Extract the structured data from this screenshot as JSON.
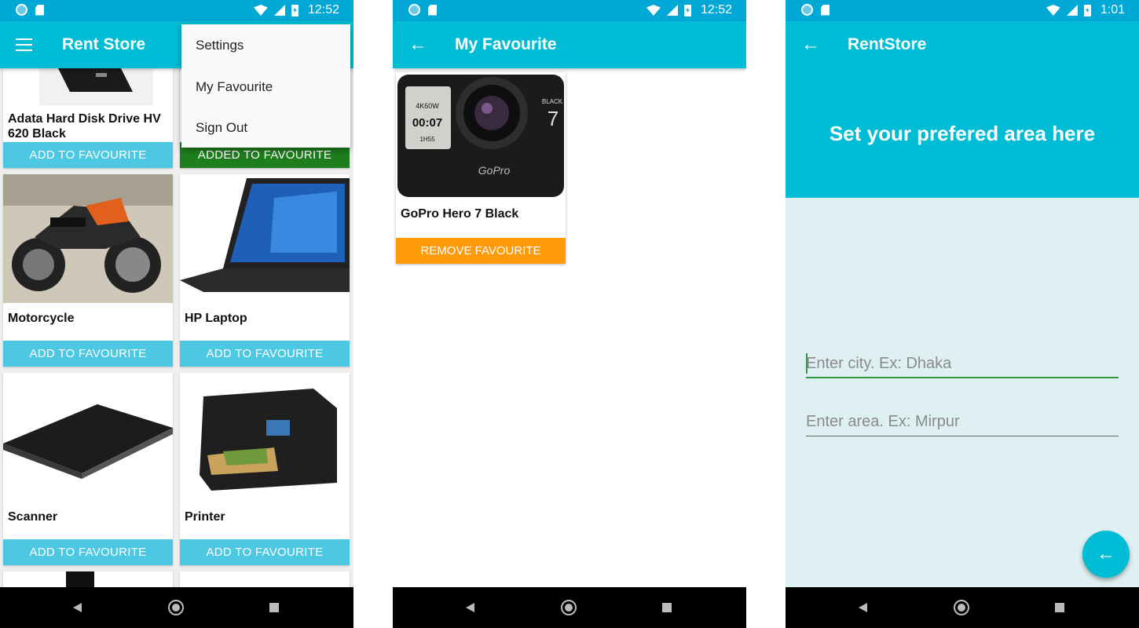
{
  "screen1": {
    "status_time": "12:52",
    "title": "Rent Store",
    "menu": [
      "Settings",
      "My Favourite",
      "Sign Out"
    ],
    "products": [
      {
        "name": "Adata Hard Disk Drive HV 620 Black",
        "button": "ADD TO FAVOURITE",
        "state": "normal"
      },
      {
        "name": "",
        "button": "ADDED TO FAVOURITE",
        "state": "added"
      },
      {
        "name": "Motorcycle",
        "button": "ADD TO FAVOURITE",
        "state": "normal"
      },
      {
        "name": "HP Laptop",
        "button": "ADD TO FAVOURITE",
        "state": "normal"
      },
      {
        "name": "Scanner",
        "button": "ADD TO FAVOURITE",
        "state": "normal"
      },
      {
        "name": "Printer",
        "button": "ADD TO FAVOURITE",
        "state": "normal"
      }
    ]
  },
  "screen2": {
    "status_time": "12:52",
    "title": "My Favourite",
    "item": {
      "name": "GoPro Hero 7 Black",
      "button": "REMOVE FAVOURITE",
      "brand": "GoPro",
      "lcd_line1": "4K60W",
      "lcd_time": "00:07",
      "lcd_line3": "1H55",
      "model_text": "BLACK",
      "model_num": "7"
    }
  },
  "screen3": {
    "status_time": "1:01",
    "title": "RentStore",
    "heading": "Set your prefered area here",
    "city_placeholder": "Enter city.  Ex: Dhaka",
    "area_placeholder": "Enter area.  Ex: Mirpur"
  },
  "colors": {
    "primary": "#00BCD4",
    "status": "#00A8D6",
    "fav_button": "#4DC8E3",
    "added_button": "#1E7E1E",
    "remove_button": "#FF9A0A",
    "area_bg": "#DFF0F2"
  },
  "icons": [
    "menu-icon",
    "back-arrow-icon",
    "wifi-icon",
    "signal-icon",
    "battery-icon",
    "nav-back-icon",
    "nav-home-icon",
    "nav-recent-icon"
  ]
}
